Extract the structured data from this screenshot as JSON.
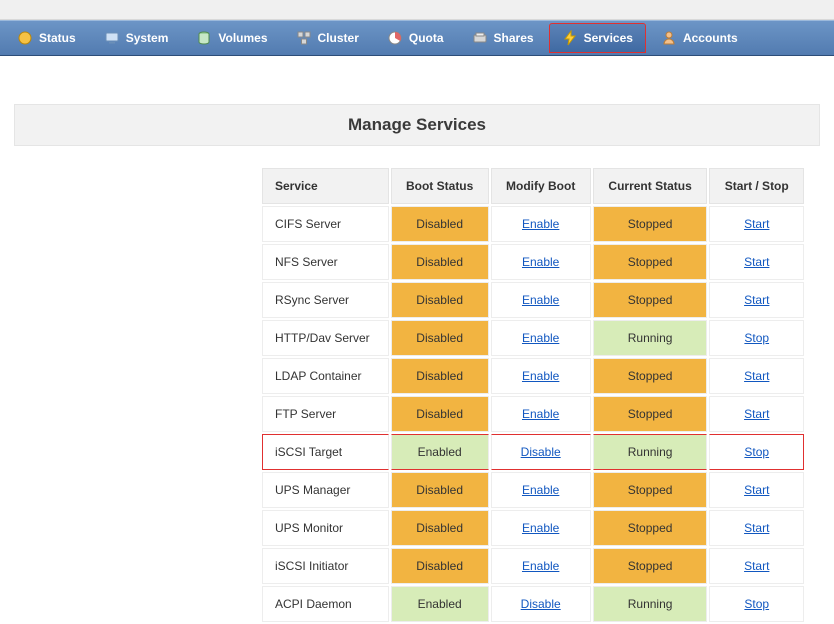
{
  "nav": [
    {
      "label": "Status",
      "icon": "status-icon",
      "active": false
    },
    {
      "label": "System",
      "icon": "system-icon",
      "active": false
    },
    {
      "label": "Volumes",
      "icon": "volumes-icon",
      "active": false
    },
    {
      "label": "Cluster",
      "icon": "cluster-icon",
      "active": false
    },
    {
      "label": "Quota",
      "icon": "quota-icon",
      "active": false
    },
    {
      "label": "Shares",
      "icon": "shares-icon",
      "active": false
    },
    {
      "label": "Services",
      "icon": "services-icon",
      "active": true
    },
    {
      "label": "Accounts",
      "icon": "accounts-icon",
      "active": false
    }
  ],
  "page_title": "Manage Services",
  "columns": {
    "service": "Service",
    "boot_status": "Boot Status",
    "modify_boot": "Modify Boot",
    "current_status": "Current Status",
    "start_stop": "Start / Stop"
  },
  "labels": {
    "enable": "Enable",
    "disable": "Disable",
    "start": "Start",
    "stop": "Stop",
    "enabled": "Enabled",
    "disabled": "Disabled",
    "running": "Running",
    "stopped": "Stopped"
  },
  "services": [
    {
      "name": "CIFS Server",
      "boot": "Disabled",
      "modify": "Enable",
      "current": "Stopped",
      "action": "Start",
      "hl": false
    },
    {
      "name": "NFS Server",
      "boot": "Disabled",
      "modify": "Enable",
      "current": "Stopped",
      "action": "Start",
      "hl": false
    },
    {
      "name": "RSync Server",
      "boot": "Disabled",
      "modify": "Enable",
      "current": "Stopped",
      "action": "Start",
      "hl": false
    },
    {
      "name": "HTTP/Dav Server",
      "boot": "Disabled",
      "modify": "Enable",
      "current": "Running",
      "action": "Stop",
      "hl": false
    },
    {
      "name": "LDAP Container",
      "boot": "Disabled",
      "modify": "Enable",
      "current": "Stopped",
      "action": "Start",
      "hl": false
    },
    {
      "name": "FTP Server",
      "boot": "Disabled",
      "modify": "Enable",
      "current": "Stopped",
      "action": "Start",
      "hl": false
    },
    {
      "name": "iSCSI Target",
      "boot": "Enabled",
      "modify": "Disable",
      "current": "Running",
      "action": "Stop",
      "hl": true
    },
    {
      "name": "UPS Manager",
      "boot": "Disabled",
      "modify": "Enable",
      "current": "Stopped",
      "action": "Start",
      "hl": false
    },
    {
      "name": "UPS Monitor",
      "boot": "Disabled",
      "modify": "Enable",
      "current": "Stopped",
      "action": "Start",
      "hl": false
    },
    {
      "name": "iSCSI Initiator",
      "boot": "Disabled",
      "modify": "Enable",
      "current": "Stopped",
      "action": "Start",
      "hl": false
    },
    {
      "name": "ACPI Daemon",
      "boot": "Enabled",
      "modify": "Disable",
      "current": "Running",
      "action": "Stop",
      "hl": false
    }
  ],
  "colors": {
    "nav_bg": "#527bb0",
    "highlight_border": "#e03030",
    "warn_bg": "#f2b441",
    "ok_bg": "#d7ecb8",
    "link": "#1157c0"
  }
}
